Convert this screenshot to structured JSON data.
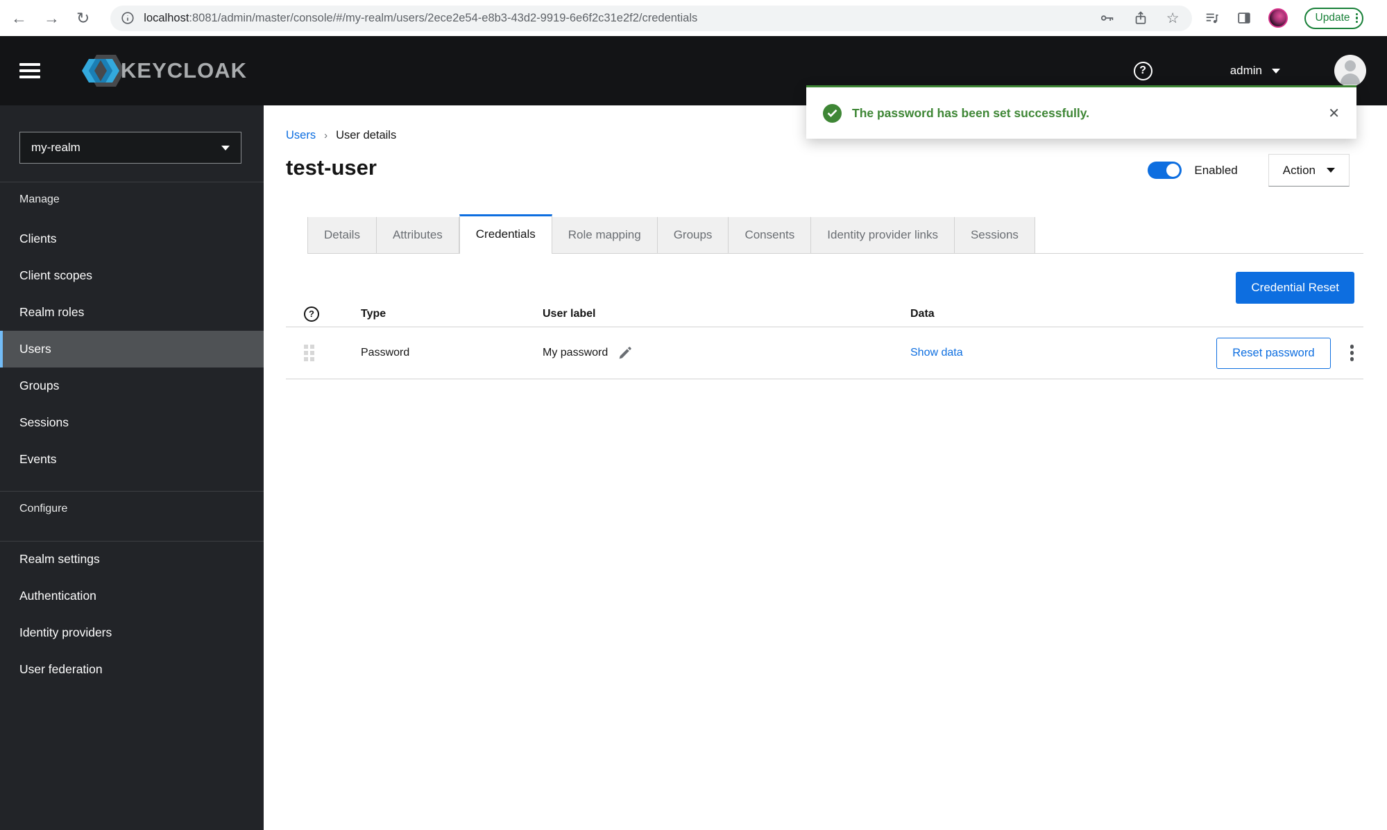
{
  "browser": {
    "url": {
      "host": "localhost",
      "path": ":8081/admin/master/console/#/my-realm/users/2ece2e54-e8b3-43d2-9919-6e6f2c31e2f2/credentials"
    },
    "update_label": "Update"
  },
  "icons": {
    "back": "←",
    "forward": "→",
    "reload": "↻",
    "star": "☆",
    "question": "?",
    "close": "✕"
  },
  "header": {
    "brand": "KEYCLOAK",
    "username": "admin"
  },
  "alert": {
    "message": "The password has been set successfully."
  },
  "sidebar": {
    "realm": "my-realm",
    "sections": {
      "manage": "Manage",
      "configure": "Configure"
    },
    "manage_items": [
      "Clients",
      "Client scopes",
      "Realm roles",
      "Users",
      "Groups",
      "Sessions",
      "Events"
    ],
    "configure_items": [
      "Realm settings",
      "Authentication",
      "Identity providers",
      "User federation"
    ],
    "active_item": "Users"
  },
  "breadcrumb": {
    "parent": "Users",
    "separator": "›",
    "current": "User details"
  },
  "page": {
    "title": "test-user",
    "enabled_label": "Enabled",
    "action_label": "Action"
  },
  "tabs": {
    "items": [
      "Details",
      "Attributes",
      "Credentials",
      "Role mapping",
      "Groups",
      "Consents",
      "Identity provider links",
      "Sessions"
    ],
    "active": "Credentials"
  },
  "credentials": {
    "reset_button_label": "Credential Reset",
    "columns": [
      "Type",
      "User label",
      "Data"
    ],
    "row": {
      "type": "Password",
      "user_label": "My password",
      "data_link_label": "Show data",
      "reset_button_label": "Reset password"
    }
  },
  "colors": {
    "primary_blue": "#0d6ee0",
    "success_green": "#3e8635",
    "chrome_update_green": "#188038",
    "active_nav_highlight": "#73bcf7",
    "header_bg": "#131416",
    "sidebar_bg": "#222428"
  }
}
